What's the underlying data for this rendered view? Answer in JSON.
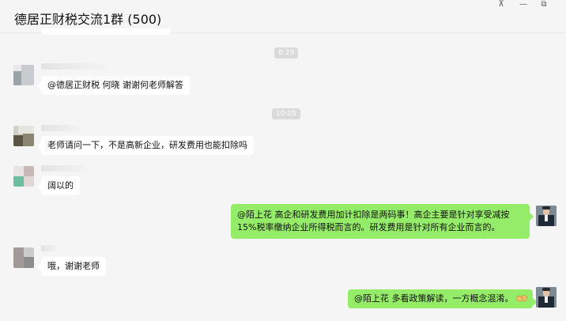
{
  "window": {
    "title": "德居正财税交流1群 (500)",
    "controls": {
      "pin": "⊼",
      "minimize": "—",
      "maximize": "⧉"
    }
  },
  "timestamps": [
    "8:29",
    "10:05"
  ],
  "messages": [
    {
      "side": "in",
      "text": "@德居正财税 何晓 谢谢何老师解答"
    },
    {
      "side": "in",
      "text": "老师请问一下，不是高新企业，研发费用也能扣除吗"
    },
    {
      "side": "in",
      "text": "阔以的"
    },
    {
      "side": "out",
      "text": "@陌上花 高企和研发费用加计扣除是两码事！高企主要是针对享受减按15%税率缴纳企业所得税而言的。研发费用是针对所有企业而言的。"
    },
    {
      "side": "in",
      "text": "哦，谢谢老师"
    },
    {
      "side": "out",
      "text": "@陌上花 多看政策解读，一方概念混淆。"
    }
  ],
  "colors": {
    "outgoing_bubble": "#95ec69",
    "incoming_bubble": "#ffffff",
    "background": "#f5f5f5"
  },
  "icons": {
    "emoji": "handshake-emoji"
  }
}
